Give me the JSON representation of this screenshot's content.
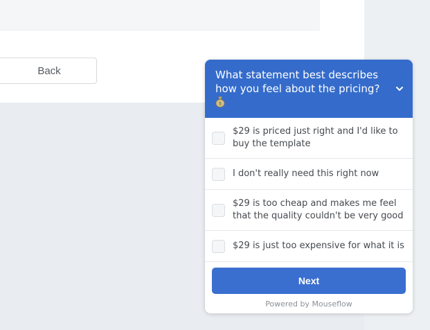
{
  "page": {
    "back_label": "Back"
  },
  "survey": {
    "question": "What statement best describes how you feel about the pricing?",
    "question_emoji": "💰",
    "options": [
      {
        "label": "$29 is priced just right and I'd like to buy the template",
        "checked": false
      },
      {
        "label": "I don't really need this right now",
        "checked": false
      },
      {
        "label": "$29 is too cheap and makes me feel that the quality couldn't be very good",
        "checked": false
      },
      {
        "label": "$29 is just too expensive for what it is",
        "checked": false
      }
    ],
    "next_label": "Next",
    "powered_by": "Powered by Mouseflow"
  },
  "colors": {
    "header_bg": "#356ccb",
    "next_bg": "#3a6fd0",
    "page_bg": "#e9edf1"
  },
  "icons": {
    "question_icon": "money-bag-icon",
    "collapse_icon": "chevron-down-icon"
  }
}
